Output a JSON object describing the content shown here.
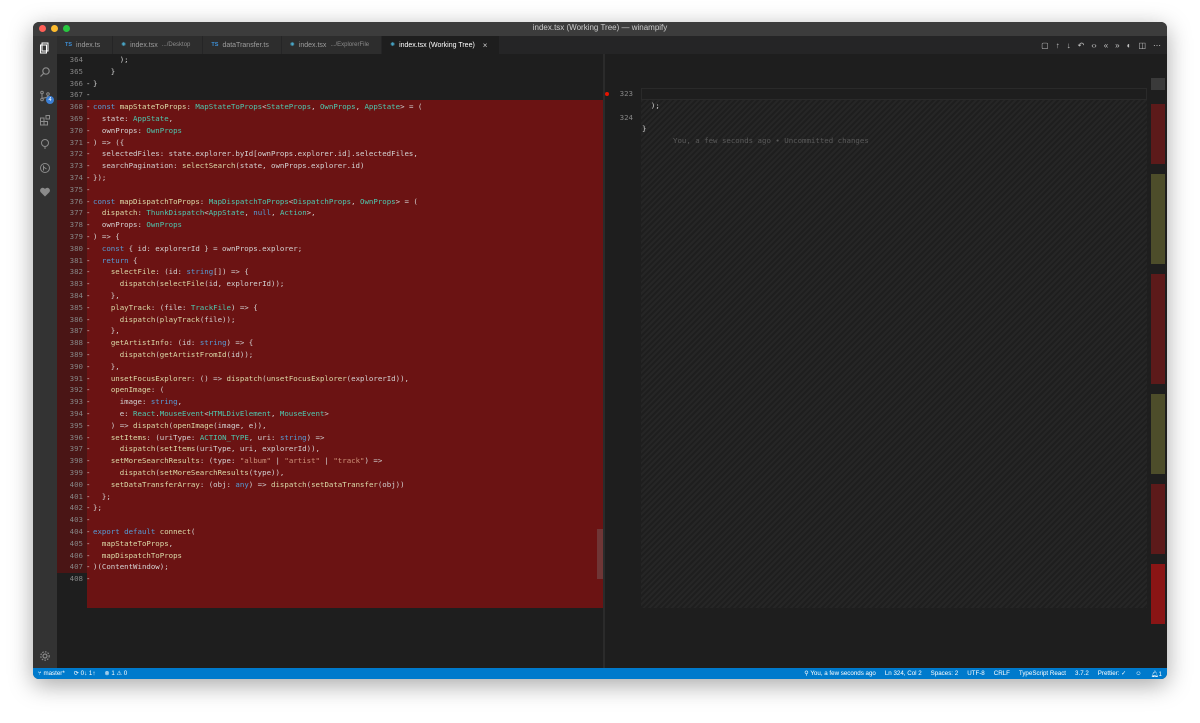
{
  "window": {
    "title": "index.tsx (Working Tree) — winampify"
  },
  "colors": {
    "deleted_line": "#6b1313",
    "status_bar": "#007acc",
    "tab_active": "#1e1e1e"
  },
  "tabs": [
    {
      "icon": "TS",
      "label": "index.ts",
      "desc": ""
    },
    {
      "icon": "⚛",
      "label": "index.tsx",
      "desc": ".../Desktop"
    },
    {
      "icon": "TS",
      "label": "dataTransfer.ts",
      "desc": ""
    },
    {
      "icon": "⚛",
      "label": "index.tsx",
      "desc": ".../ExplorerFile"
    },
    {
      "icon": "⚛",
      "label": "index.tsx (Working Tree)",
      "desc": "",
      "close": "×"
    }
  ],
  "activity": {
    "scm_badge": "4"
  },
  "left_lines": [
    {
      "n": "364",
      "m": "",
      "code": "      );"
    },
    {
      "n": "365",
      "m": "",
      "code": "    }"
    },
    {
      "n": "366",
      "m": "-",
      "code": "}"
    },
    {
      "n": "367",
      "m": "-",
      "code": ""
    },
    {
      "n": "368",
      "m": "-",
      "code": "const mapStateToProps: MapStateToProps<StateProps, OwnProps, AppState> = ("
    },
    {
      "n": "369",
      "m": "-",
      "code": "  state: AppState,"
    },
    {
      "n": "370",
      "m": "-",
      "code": "  ownProps: OwnProps"
    },
    {
      "n": "371",
      "m": "-",
      "code": ") => ({"
    },
    {
      "n": "372",
      "m": "-",
      "code": "  selectedFiles: state.explorer.byId[ownProps.explorer.id].selectedFiles,"
    },
    {
      "n": "373",
      "m": "-",
      "code": "  searchPagination: selectSearch(state, ownProps.explorer.id)"
    },
    {
      "n": "374",
      "m": "-",
      "code": "});"
    },
    {
      "n": "375",
      "m": "-",
      "code": ""
    },
    {
      "n": "376",
      "m": "-",
      "code": "const mapDispatchToProps: MapDispatchToProps<DispatchProps, OwnProps> = ("
    },
    {
      "n": "377",
      "m": "-",
      "code": "  dispatch: ThunkDispatch<AppState, null, Action>,"
    },
    {
      "n": "378",
      "m": "-",
      "code": "  ownProps: OwnProps"
    },
    {
      "n": "379",
      "m": "-",
      "code": ") => {"
    },
    {
      "n": "380",
      "m": "-",
      "code": "  const { id: explorerId } = ownProps.explorer;"
    },
    {
      "n": "381",
      "m": "-",
      "code": "  return {"
    },
    {
      "n": "382",
      "m": "-",
      "code": "    selectFile: (id: string[]) => {"
    },
    {
      "n": "383",
      "m": "-",
      "code": "      dispatch(selectFile(id, explorerId));"
    },
    {
      "n": "384",
      "m": "-",
      "code": "    },"
    },
    {
      "n": "385",
      "m": "-",
      "code": "    playTrack: (file: TrackFile) => {"
    },
    {
      "n": "386",
      "m": "-",
      "code": "      dispatch(playTrack(file));"
    },
    {
      "n": "387",
      "m": "-",
      "code": "    },"
    },
    {
      "n": "388",
      "m": "-",
      "code": "    getArtistInfo: (id: string) => {"
    },
    {
      "n": "389",
      "m": "-",
      "code": "      dispatch(getArtistFromId(id));"
    },
    {
      "n": "390",
      "m": "-",
      "code": "    },"
    },
    {
      "n": "391",
      "m": "-",
      "code": "    unsetFocusExplorer: () => dispatch(unsetFocusExplorer(explorerId)),"
    },
    {
      "n": "392",
      "m": "-",
      "code": "    openImage: ("
    },
    {
      "n": "393",
      "m": "-",
      "code": "      image: string,"
    },
    {
      "n": "394",
      "m": "-",
      "code": "      e: React.MouseEvent<HTMLDivElement, MouseEvent>"
    },
    {
      "n": "395",
      "m": "-",
      "code": "    ) => dispatch(openImage(image, e)),"
    },
    {
      "n": "396",
      "m": "-",
      "code": "    setItems: (uriType: ACTION_TYPE, uri: string) =>"
    },
    {
      "n": "397",
      "m": "-",
      "code": "      dispatch(setItems(uriType, uri, explorerId)),"
    },
    {
      "n": "398",
      "m": "-",
      "code": "    setMoreSearchResults: (type: \"album\" | \"artist\" | \"track\") =>"
    },
    {
      "n": "399",
      "m": "-",
      "code": "      dispatch(setMoreSearchResults(type)),"
    },
    {
      "n": "400",
      "m": "-",
      "code": "    setDataTransferArray: (obj: any) => dispatch(setDataTransfer(obj))"
    },
    {
      "n": "401",
      "m": "-",
      "code": "  };"
    },
    {
      "n": "402",
      "m": "-",
      "code": "};"
    },
    {
      "n": "403",
      "m": "-",
      "code": ""
    },
    {
      "n": "404",
      "m": "-",
      "code": "export default connect("
    },
    {
      "n": "405",
      "m": "-",
      "code": "  mapStateToProps,"
    },
    {
      "n": "406",
      "m": "-",
      "code": "  mapDispatchToProps"
    },
    {
      "n": "407",
      "m": "-",
      "code": ")(ContentWindow);"
    },
    {
      "n": "408",
      "m": "-",
      "code": ""
    }
  ],
  "right_lines": [
    {
      "n": "323",
      "code": "  );",
      "blame": ""
    },
    {
      "n": "324",
      "code": "}",
      "blame": "You, a few seconds ago • Uncommitted changes"
    }
  ],
  "status": {
    "branch": "master*",
    "sync": "0↓ 1↑",
    "problems": "1 ⚠ 0",
    "blame": "You, a few seconds ago",
    "position": "Ln 324, Col 2",
    "spaces": "Spaces: 2",
    "encoding": "UTF-8",
    "eol": "CRLF",
    "language": "TypeScript React",
    "version": "3.7.2",
    "prettier": "Prettier: ✓"
  }
}
